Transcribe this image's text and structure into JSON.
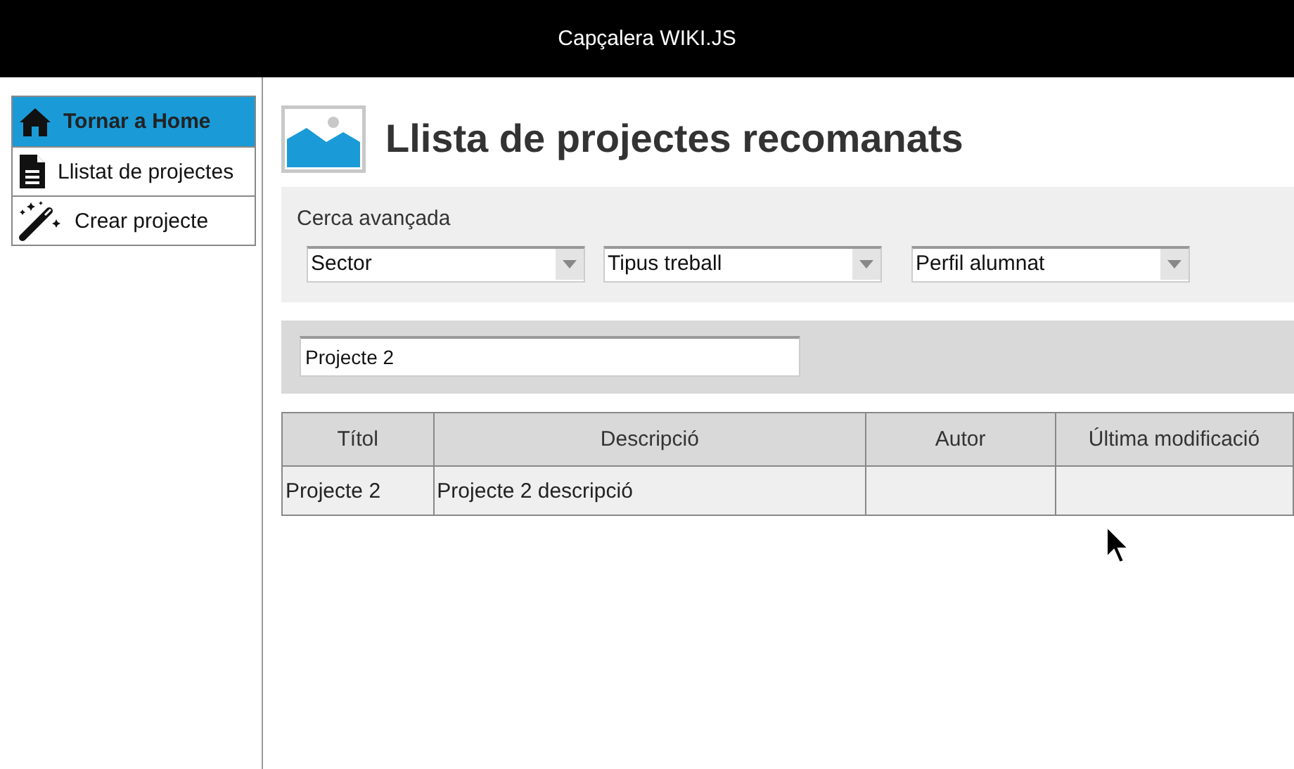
{
  "header": {
    "title": "Capçalera WIKI.JS"
  },
  "sidebar": {
    "items": [
      {
        "label": "Tornar a Home",
        "selected": true
      },
      {
        "label": "Llistat de projectes",
        "selected": false
      },
      {
        "label": "Crear projecte",
        "selected": false
      }
    ]
  },
  "page": {
    "title": "Llista de projectes recomanats"
  },
  "advanced_search": {
    "label": "Cerca avançada",
    "filters": [
      {
        "value": "Sector"
      },
      {
        "value": "Tipus treball"
      },
      {
        "value": "Perfil alumnat"
      }
    ]
  },
  "search": {
    "value": "Projecte 2"
  },
  "table": {
    "columns": [
      "Títol",
      "Descripció",
      "Autor",
      "Última modificació"
    ],
    "rows": [
      [
        "Projecte 2",
        "Projecte 2 descripció",
        "",
        ""
      ]
    ]
  }
}
